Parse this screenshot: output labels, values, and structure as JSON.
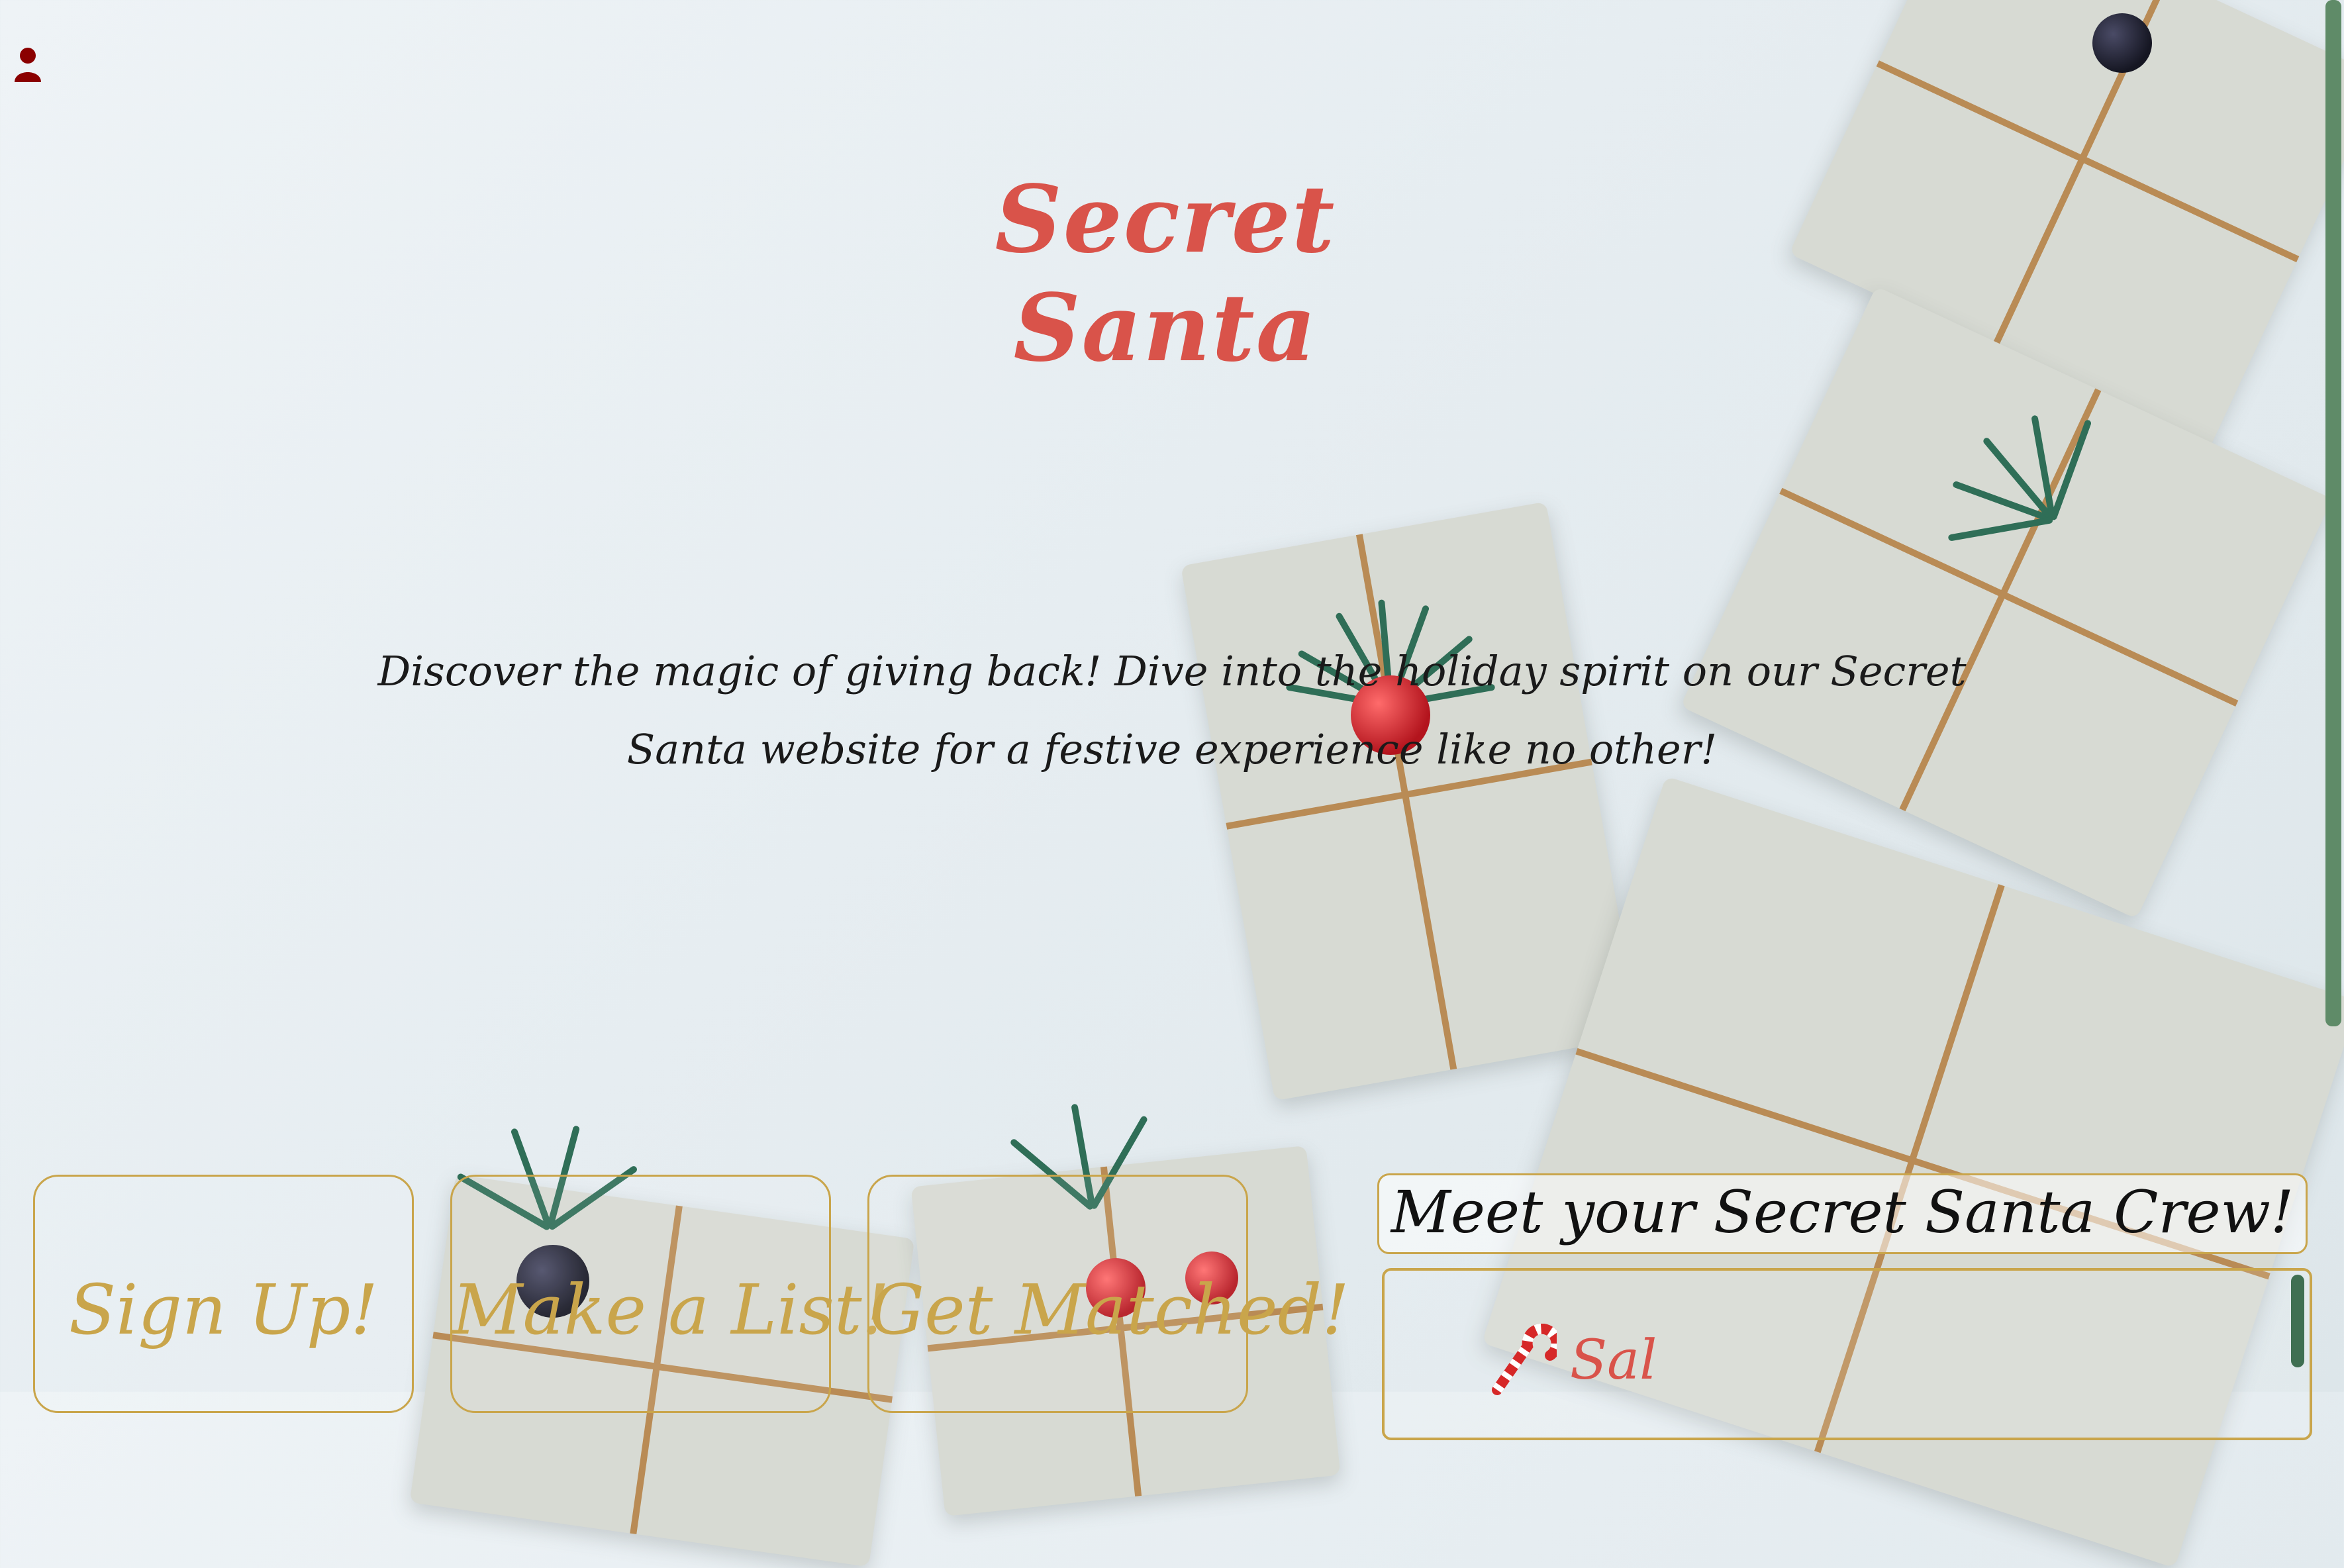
{
  "header": {
    "title": "Secret Santa"
  },
  "hero": {
    "tagline": "Discover the magic of giving back! Dive into the holiday spirit on our Secret Santa website for a festive experience like no other!"
  },
  "steps": [
    {
      "label": "Sign Up!"
    },
    {
      "label": "Make a List!"
    },
    {
      "label": "Get Matched!"
    }
  ],
  "crew": {
    "heading": "Meet your Secret Santa Crew!",
    "members": [
      {
        "name": "Sal"
      }
    ]
  },
  "colors": {
    "title": "#d9534a",
    "accent_gold": "#c9a54b",
    "user_icon": "#8b0000",
    "scrollbar": "#5f8b68"
  },
  "icons": {
    "account": "user-icon",
    "member": "candy-cane-icon"
  }
}
